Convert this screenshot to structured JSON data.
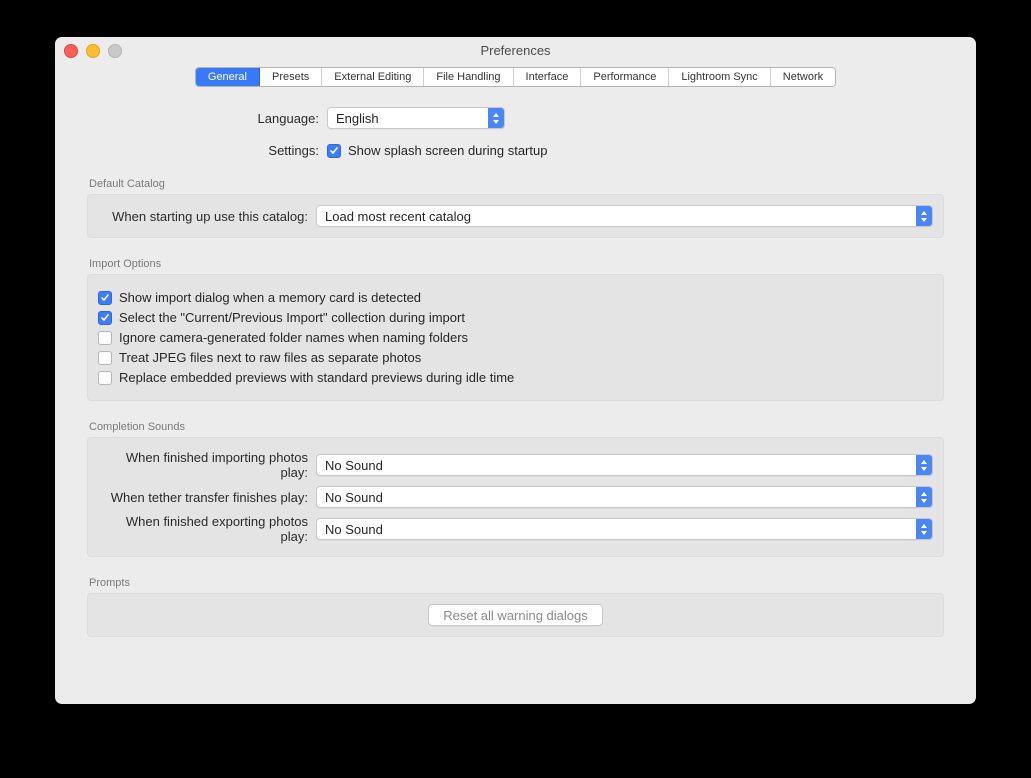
{
  "window_title": "Preferences",
  "tabs": {
    "general": "General",
    "presets": "Presets",
    "external_editing": "External Editing",
    "file_handling": "File Handling",
    "interface": "Interface",
    "performance": "Performance",
    "lightroom_sync": "Lightroom Sync",
    "network": "Network"
  },
  "labels": {
    "language": "Language:",
    "settings": "Settings:",
    "splash": "Show splash screen during startup"
  },
  "language_value": "English",
  "default_catalog": {
    "section": "Default Catalog",
    "label": "When starting up use this catalog:",
    "value": "Load most recent catalog"
  },
  "import_options": {
    "section": "Import Options",
    "opt1": "Show import dialog when a memory card is detected",
    "opt2": "Select the \"Current/Previous Import\" collection during import",
    "opt3": "Ignore camera-generated folder names when naming folders",
    "opt4": "Treat JPEG files next to raw files as separate photos",
    "opt5": "Replace embedded previews with standard previews during idle time"
  },
  "completion_sounds": {
    "section": "Completion Sounds",
    "importing_label": "When finished importing photos play:",
    "tether_label": "When tether transfer finishes play:",
    "exporting_label": "When finished exporting photos play:",
    "importing_value": "No Sound",
    "tether_value": "No Sound",
    "exporting_value": "No Sound"
  },
  "prompts": {
    "section": "Prompts",
    "reset_button": "Reset all warning dialogs"
  }
}
